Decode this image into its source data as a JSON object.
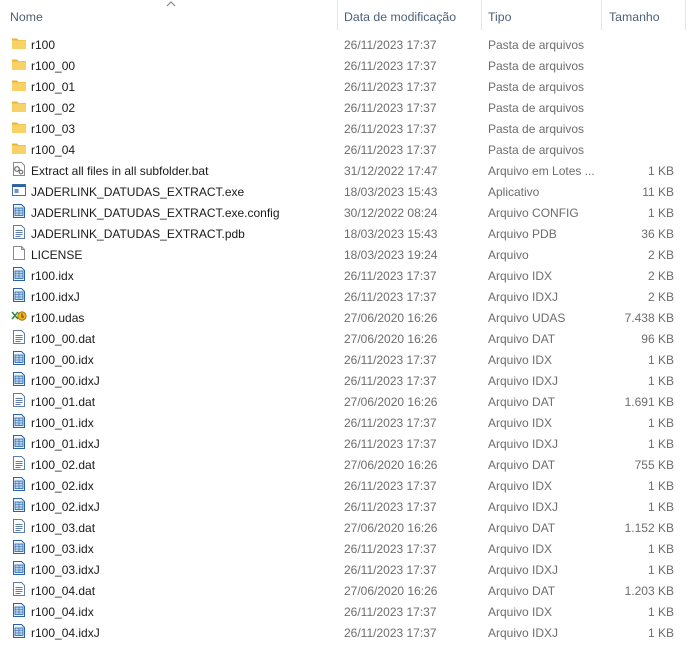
{
  "columns": {
    "name": "Nome",
    "date": "Data de modificação",
    "type": "Tipo",
    "size": "Tamanho"
  },
  "sort": {
    "column": "name",
    "direction": "ascending"
  },
  "icon_colors": {
    "folder": "#f7cf5a",
    "folder_tab": "#e8b531",
    "file_blue": "#2a62a8"
  },
  "files": [
    {
      "icon": "folder-icon",
      "name": "r100",
      "date": "26/11/2023 17:37",
      "type": "Pasta de arquivos",
      "size": ""
    },
    {
      "icon": "folder-icon",
      "name": "r100_00",
      "date": "26/11/2023 17:37",
      "type": "Pasta de arquivos",
      "size": ""
    },
    {
      "icon": "folder-icon",
      "name": "r100_01",
      "date": "26/11/2023 17:37",
      "type": "Pasta de arquivos",
      "size": ""
    },
    {
      "icon": "folder-icon",
      "name": "r100_02",
      "date": "26/11/2023 17:37",
      "type": "Pasta de arquivos",
      "size": ""
    },
    {
      "icon": "folder-icon",
      "name": "r100_03",
      "date": "26/11/2023 17:37",
      "type": "Pasta de arquivos",
      "size": ""
    },
    {
      "icon": "folder-icon",
      "name": "r100_04",
      "date": "26/11/2023 17:37",
      "type": "Pasta de arquivos",
      "size": ""
    },
    {
      "icon": "batch-file-icon",
      "name": "Extract all files in all subfolder.bat",
      "date": "31/12/2022 17:47",
      "type": "Arquivo em Lotes ...",
      "size": "1 KB"
    },
    {
      "icon": "exe-icon",
      "name": "JADERLINK_DATUDAS_EXTRACT.exe",
      "date": "18/03/2023 15:43",
      "type": "Aplicativo",
      "size": "11 KB"
    },
    {
      "icon": "data-file-icon",
      "name": "JADERLINK_DATUDAS_EXTRACT.exe.config",
      "date": "30/12/2022 08:24",
      "type": "Arquivo CONFIG",
      "size": "1 KB"
    },
    {
      "icon": "text-file-icon",
      "name": "JADERLINK_DATUDAS_EXTRACT.pdb",
      "date": "18/03/2023 15:43",
      "type": "Arquivo PDB",
      "size": "36 KB"
    },
    {
      "icon": "blank-file-icon",
      "name": "LICENSE",
      "date": "18/03/2023 19:24",
      "type": "Arquivo",
      "size": "2 KB"
    },
    {
      "icon": "data-file-icon",
      "name": "r100.idx",
      "date": "26/11/2023 17:37",
      "type": "Arquivo IDX",
      "size": "2 KB"
    },
    {
      "icon": "data-file-icon",
      "name": "r100.idxJ",
      "date": "26/11/2023 17:37",
      "type": "Arquivo IDXJ",
      "size": "2 KB"
    },
    {
      "icon": "udas-file-icon",
      "name": "r100.udas",
      "date": "27/06/2020 16:26",
      "type": "Arquivo UDAS",
      "size": "7.438 KB"
    },
    {
      "icon": "text-file-icon",
      "name": "r100_00.dat",
      "date": "27/06/2020 16:26",
      "type": "Arquivo DAT",
      "size": "96 KB"
    },
    {
      "icon": "data-file-icon",
      "name": "r100_00.idx",
      "date": "26/11/2023 17:37",
      "type": "Arquivo IDX",
      "size": "1 KB"
    },
    {
      "icon": "data-file-icon",
      "name": "r100_00.idxJ",
      "date": "26/11/2023 17:37",
      "type": "Arquivo IDXJ",
      "size": "1 KB"
    },
    {
      "icon": "text-file-icon",
      "name": "r100_01.dat",
      "date": "27/06/2020 16:26",
      "type": "Arquivo DAT",
      "size": "1.691 KB"
    },
    {
      "icon": "data-file-icon",
      "name": "r100_01.idx",
      "date": "26/11/2023 17:37",
      "type": "Arquivo IDX",
      "size": "1 KB"
    },
    {
      "icon": "data-file-icon",
      "name": "r100_01.idxJ",
      "date": "26/11/2023 17:37",
      "type": "Arquivo IDXJ",
      "size": "1 KB"
    },
    {
      "icon": "text-file-icon",
      "name": "r100_02.dat",
      "date": "27/06/2020 16:26",
      "type": "Arquivo DAT",
      "size": "755 KB"
    },
    {
      "icon": "data-file-icon",
      "name": "r100_02.idx",
      "date": "26/11/2023 17:37",
      "type": "Arquivo IDX",
      "size": "1 KB"
    },
    {
      "icon": "data-file-icon",
      "name": "r100_02.idxJ",
      "date": "26/11/2023 17:37",
      "type": "Arquivo IDXJ",
      "size": "1 KB"
    },
    {
      "icon": "text-file-icon",
      "name": "r100_03.dat",
      "date": "27/06/2020 16:26",
      "type": "Arquivo DAT",
      "size": "1.152 KB"
    },
    {
      "icon": "data-file-icon",
      "name": "r100_03.idx",
      "date": "26/11/2023 17:37",
      "type": "Arquivo IDX",
      "size": "1 KB"
    },
    {
      "icon": "data-file-icon",
      "name": "r100_03.idxJ",
      "date": "26/11/2023 17:37",
      "type": "Arquivo IDXJ",
      "size": "1 KB"
    },
    {
      "icon": "text-file-icon",
      "name": "r100_04.dat",
      "date": "27/06/2020 16:26",
      "type": "Arquivo DAT",
      "size": "1.203 KB"
    },
    {
      "icon": "data-file-icon",
      "name": "r100_04.idx",
      "date": "26/11/2023 17:37",
      "type": "Arquivo IDX",
      "size": "1 KB"
    },
    {
      "icon": "data-file-icon",
      "name": "r100_04.idxJ",
      "date": "26/11/2023 17:37",
      "type": "Arquivo IDXJ",
      "size": "1 KB"
    }
  ]
}
